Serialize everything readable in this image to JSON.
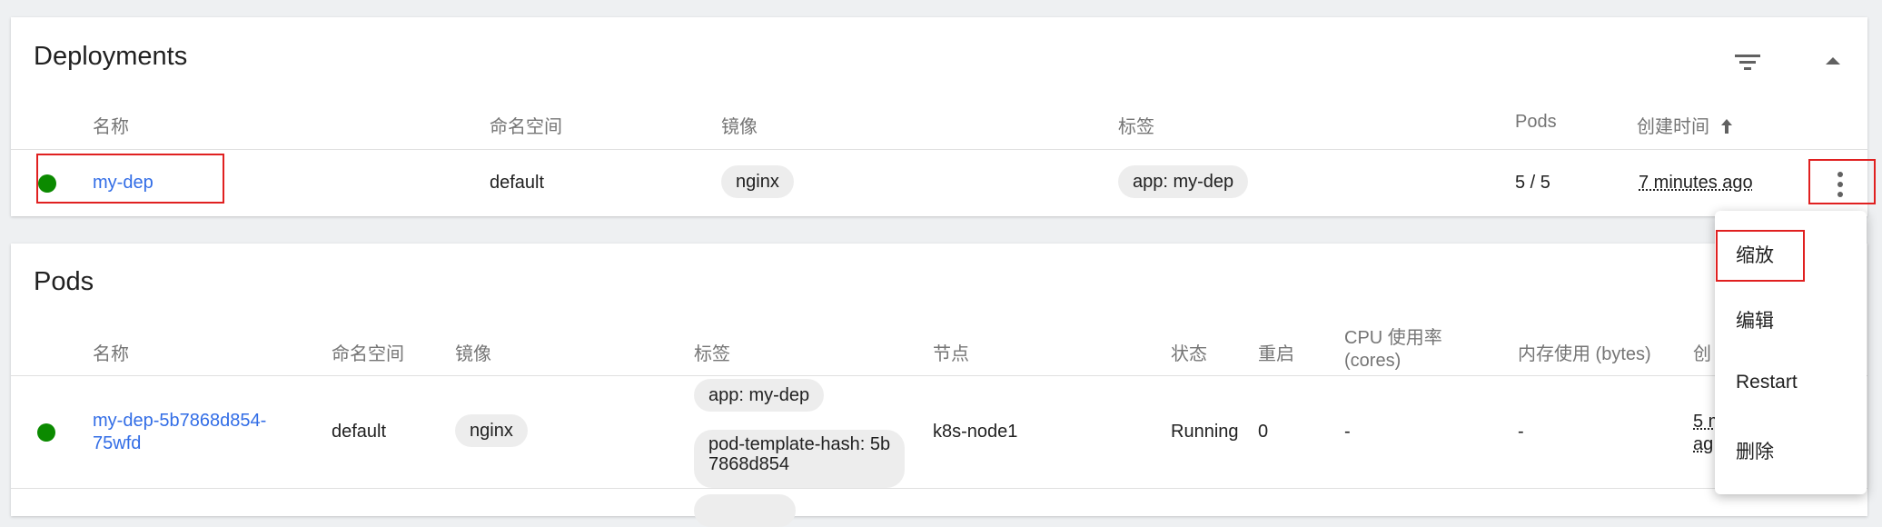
{
  "deployments": {
    "title": "Deployments",
    "headers": {
      "name": "名称",
      "namespace": "命名空间",
      "image": "镜像",
      "labels": "标签",
      "pods": "Pods",
      "created": "创建时间"
    },
    "row": {
      "name": "my-dep",
      "namespace": "default",
      "image": "nginx",
      "label": "app: my-dep",
      "pods": "5 / 5",
      "created": "7 minutes ago"
    }
  },
  "pods": {
    "title": "Pods",
    "headers": {
      "name": "名称",
      "namespace": "命名空间",
      "image": "镜像",
      "labels": "标签",
      "node": "节点",
      "status": "状态",
      "restarts": "重启",
      "cpu_line1": "CPU 使用率",
      "cpu_line2": "(cores)",
      "memory": "内存使用 (bytes)",
      "created_partial": "创"
    },
    "row": {
      "name_line1": "my-dep-5b7868d854-",
      "name_line2": "75wfd",
      "namespace": "default",
      "image": "nginx",
      "label1": "app: my-dep",
      "label2_line1": "pod-template-hash: 5b",
      "label2_line2": "7868d854",
      "node": "k8s-node1",
      "status": "Running",
      "restarts": "0",
      "cpu": "-",
      "memory": "-",
      "created_line1": "5 m",
      "created_line2": "ag"
    }
  },
  "menu": {
    "items": [
      "缩放",
      "编辑",
      "Restart",
      "删除"
    ]
  },
  "colors": {
    "status_ok": "#0b8a00",
    "link": "#326de6",
    "highlight": "#e02020"
  },
  "icons": {
    "filter": "filter-icon",
    "collapse": "caret-up-icon",
    "more": "more-vert-icon",
    "sort": "arrow-up-icon"
  }
}
